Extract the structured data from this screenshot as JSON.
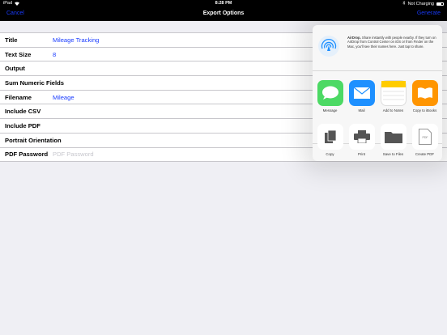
{
  "status_bar": {
    "device": "iPad",
    "time": "8:28 PM",
    "battery_text": "Not Charging"
  },
  "nav": {
    "cancel_label": "Cancel",
    "title": "Export Options",
    "action_label": "Generate"
  },
  "form": {
    "rows": [
      {
        "label": "Title",
        "value": "Mileage Tracking"
      },
      {
        "label": "Text Size",
        "value": "8"
      },
      {
        "label": "Output",
        "value": ""
      },
      {
        "label": "Sum Numeric Fields",
        "value": ""
      },
      {
        "label": "Filename",
        "value": "Mileage"
      },
      {
        "label": "Include CSV",
        "value": ""
      },
      {
        "label": "Include PDF",
        "value": ""
      },
      {
        "label": "Portrait Orientation",
        "value": ""
      },
      {
        "label": "PDF Password",
        "placeholder": "PDF Password"
      }
    ]
  },
  "share_sheet": {
    "airdrop": {
      "title": "AirDrop.",
      "description": "Share instantly with people nearby. If they turn on AirDrop from Control Center on iOS or from Finder on the Mac, you'll see their names here. Just tap to share."
    },
    "apps": [
      {
        "label": "Message",
        "icon": "messages-icon",
        "color": "#4cd964"
      },
      {
        "label": "Mail",
        "icon": "mail-icon",
        "color": "#1e90ff"
      },
      {
        "label": "Add to Notes",
        "icon": "notes-icon",
        "color": "#ffffff"
      },
      {
        "label": "Copy to iBooks",
        "icon": "ibooks-icon",
        "color": "#ff9500"
      }
    ],
    "actions": [
      {
        "label": "Copy",
        "icon": "copy-icon"
      },
      {
        "label": "Print",
        "icon": "print-icon"
      },
      {
        "label": "Save to Files",
        "icon": "folder-icon"
      },
      {
        "label": "Create PDF",
        "icon": "pdf-icon",
        "icon_text": "PDF"
      }
    ]
  },
  "colors": {
    "accent": "#1a3cff",
    "background": "#efeff4"
  }
}
